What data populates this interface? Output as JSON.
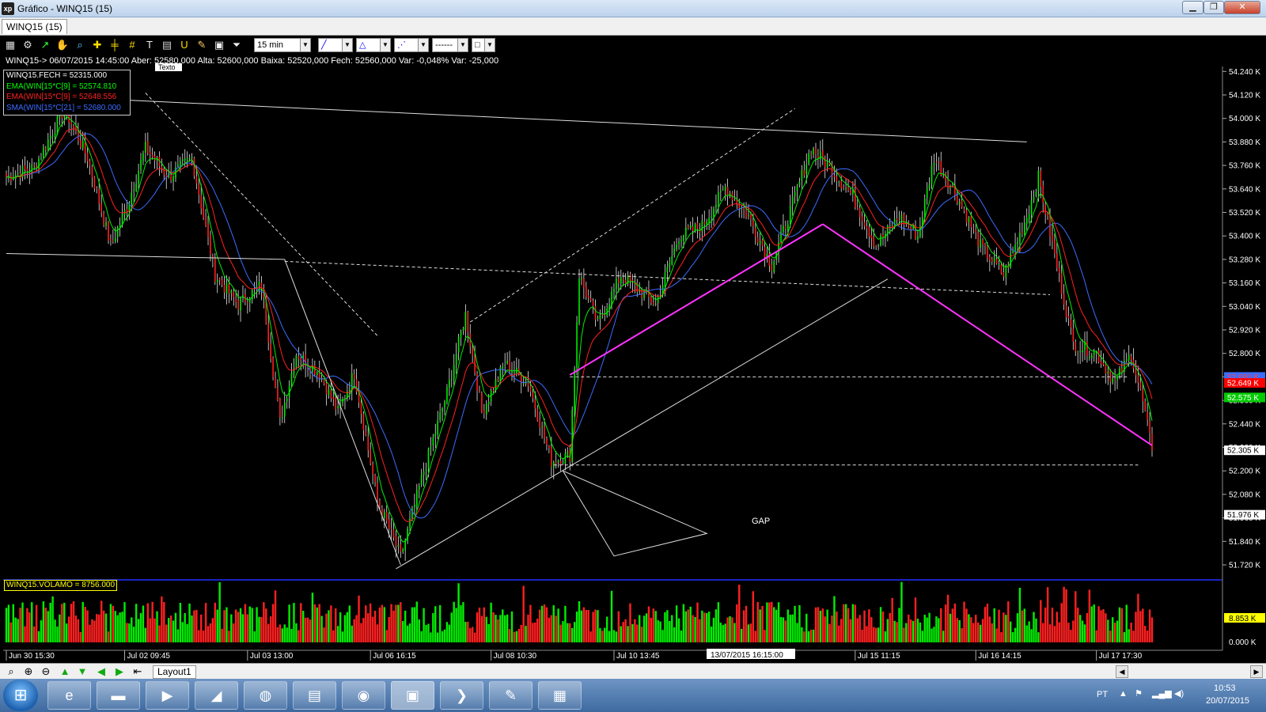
{
  "window": {
    "title": "Gráfico - WINQ15 (15)",
    "app_icon": "xp",
    "min_label": "▁",
    "max_label": "❐",
    "close_label": "✕"
  },
  "tab": {
    "label": "WINQ15 (15)"
  },
  "toolbar": {
    "interval": "15 min",
    "line_style": "------"
  },
  "info_line": "WINQ15-> 06/07/2015 14:45:00 Aber: 52580,000 Alta: 52600,000 Baixa: 52520,000 Fech: 52560,000 Var: -0,048% Var: -25,000",
  "texto_label": "Texto",
  "legend": [
    {
      "text": "WINQ15.FECH = 52315.000",
      "color": "#ffffff"
    },
    {
      "text": "EMA(WIN[15*C[9] = 52574.810",
      "color": "#00ff00"
    },
    {
      "text": "EMA(WIN[15*C[9] = 52648.556",
      "color": "#ff2020"
    },
    {
      "text": "SMA(WIN[15*C[21] = 52680.000",
      "color": "#3c6cff"
    }
  ],
  "annotations": {
    "gap": "GAP"
  },
  "price_axis": {
    "ticks": [
      "54.240 K",
      "54.120 K",
      "54.000 K",
      "53.880 K",
      "53.760 K",
      "53.640 K",
      "53.520 K",
      "53.400 K",
      "53.280 K",
      "53.160 K",
      "53.040 K",
      "52.920 K",
      "52.800 K",
      "52.680 K",
      "52.560 K",
      "52.440 K",
      "52.320 K",
      "52.200 K",
      "52.080 K",
      "51.960 K",
      "51.840 K",
      "51.720 K"
    ],
    "tick_values": [
      54240,
      54120,
      54000,
      53880,
      53760,
      53640,
      53520,
      53400,
      53280,
      53160,
      53040,
      52920,
      52800,
      52680,
      52560,
      52440,
      52320,
      52200,
      52080,
      51960,
      51840,
      51720
    ],
    "markers": [
      {
        "label": "52.680 K",
        "value": 52680,
        "color": "#3c6cff",
        "text_color": "#ff4040"
      },
      {
        "label": "52.649 K",
        "value": 52649,
        "color": "#ff0000",
        "text_color": "#ffffff"
      },
      {
        "label": "52.575 K",
        "value": 52575,
        "color": "#00cc00",
        "text_color": "#ffffff"
      },
      {
        "label": "52.305 K",
        "value": 52305,
        "color": "#ffffff",
        "text_color": "#000000"
      },
      {
        "label": "51.976 K",
        "value": 51976,
        "color": "#ffffff",
        "text_color": "#000000"
      }
    ]
  },
  "volume": {
    "legend": "WINQ15.VOLAMO = 8756.000",
    "marker": "8.853 K",
    "zero": "0.000 K"
  },
  "time_axis": {
    "labels": [
      "Jun 30 15:30",
      "Jul 02 09:45",
      "Jul 03 13:00",
      "Jul 06 16:15",
      "Jul 08 10:30",
      "Jul 10 13:45",
      "Jul 15 11:15",
      "Jul 16 14:15",
      "Jul 17 17:30"
    ],
    "cursor_label": "13/07/2015 16:15:00"
  },
  "statusbar": {
    "layout_tab": "Layout1"
  },
  "tray": {
    "lang": "PT",
    "time": "10:53",
    "date": "20/07/2015"
  },
  "chart_data": {
    "type": "candlestick",
    "symbol": "WINQ15",
    "interval": "15 min",
    "ylim": [
      51680,
      54300
    ],
    "series": [
      {
        "name": "WINQ15.FECH",
        "last": 52315
      },
      {
        "name": "EMA(WIN[15*C[9]",
        "last": 52574.81
      },
      {
        "name": "EMA(WIN[15*C[9]",
        "last": 52648.556
      },
      {
        "name": "SMA(WIN[15*C[21]",
        "last": 52680
      }
    ],
    "close_keypoints": [
      {
        "i": 0,
        "v": 53700
      },
      {
        "i": 12,
        "v": 53750
      },
      {
        "i": 25,
        "v": 54050
      },
      {
        "i": 35,
        "v": 53800
      },
      {
        "i": 45,
        "v": 53350
      },
      {
        "i": 52,
        "v": 53550
      },
      {
        "i": 60,
        "v": 53850
      },
      {
        "i": 70,
        "v": 53700
      },
      {
        "i": 80,
        "v": 53800
      },
      {
        "i": 90,
        "v": 53200
      },
      {
        "i": 100,
        "v": 53050
      },
      {
        "i": 110,
        "v": 53150
      },
      {
        "i": 118,
        "v": 52450
      },
      {
        "i": 125,
        "v": 52800
      },
      {
        "i": 135,
        "v": 52700
      },
      {
        "i": 143,
        "v": 52500
      },
      {
        "i": 150,
        "v": 52700
      },
      {
        "i": 160,
        "v": 52050
      },
      {
        "i": 170,
        "v": 51760
      },
      {
        "i": 180,
        "v": 52200
      },
      {
        "i": 190,
        "v": 52600
      },
      {
        "i": 198,
        "v": 53000
      },
      {
        "i": 205,
        "v": 52500
      },
      {
        "i": 215,
        "v": 52750
      },
      {
        "i": 225,
        "v": 52650
      },
      {
        "i": 235,
        "v": 52250
      },
      {
        "i": 243,
        "v": 52280
      },
      {
        "i": 247,
        "v": 53200
      },
      {
        "i": 255,
        "v": 52950
      },
      {
        "i": 265,
        "v": 53200
      },
      {
        "i": 280,
        "v": 53050
      },
      {
        "i": 290,
        "v": 53400
      },
      {
        "i": 300,
        "v": 53450
      },
      {
        "i": 310,
        "v": 53650
      },
      {
        "i": 320,
        "v": 53500
      },
      {
        "i": 330,
        "v": 53250
      },
      {
        "i": 340,
        "v": 53600
      },
      {
        "i": 347,
        "v": 53850
      },
      {
        "i": 355,
        "v": 53750
      },
      {
        "i": 365,
        "v": 53600
      },
      {
        "i": 375,
        "v": 53350
      },
      {
        "i": 385,
        "v": 53500
      },
      {
        "i": 393,
        "v": 53400
      },
      {
        "i": 400,
        "v": 53800
      },
      {
        "i": 410,
        "v": 53600
      },
      {
        "i": 420,
        "v": 53350
      },
      {
        "i": 430,
        "v": 53200
      },
      {
        "i": 440,
        "v": 53500
      },
      {
        "i": 445,
        "v": 53700
      },
      {
        "i": 452,
        "v": 53300
      },
      {
        "i": 460,
        "v": 52850
      },
      {
        "i": 470,
        "v": 52800
      },
      {
        "i": 478,
        "v": 52650
      },
      {
        "i": 485,
        "v": 52800
      },
      {
        "i": 490,
        "v": 52550
      },
      {
        "i": 494,
        "v": 52305
      }
    ]
  }
}
